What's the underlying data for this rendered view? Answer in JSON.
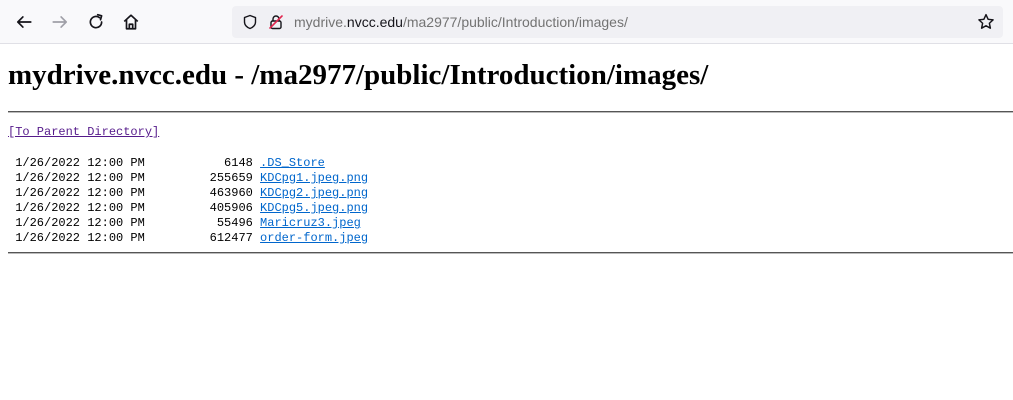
{
  "browser": {
    "url_domain": "mydrive.nvcc.edu",
    "url_path": "/ma2977/public/Introduction/images/",
    "url_prefix": "mydrive."
  },
  "page": {
    "heading": "mydrive.nvcc.edu - /ma2977/public/Introduction/images/",
    "parent_link": "[To Parent Directory]",
    "files": [
      {
        "date": "1/26/2022",
        "time": "12:00 PM",
        "size": "6148",
        "name": ".DS_Store"
      },
      {
        "date": "1/26/2022",
        "time": "12:00 PM",
        "size": "255659",
        "name": "KDCpg1.jpeg.png"
      },
      {
        "date": "1/26/2022",
        "time": "12:00 PM",
        "size": "463960",
        "name": "KDCpg2.jpeg.png"
      },
      {
        "date": "1/26/2022",
        "time": "12:00 PM",
        "size": "405906",
        "name": "KDCpg5.jpeg.png"
      },
      {
        "date": "1/26/2022",
        "time": "12:00 PM",
        "size": "55496",
        "name": "Maricruz3.jpeg"
      },
      {
        "date": "1/26/2022",
        "time": "12:00 PM",
        "size": "612477",
        "name": "order-form.jpeg"
      }
    ]
  },
  "colors": {
    "link": "#0066cc",
    "visited_link": "#551a8b"
  },
  "icons": [
    "back-arrow-icon",
    "forward-arrow-icon",
    "reload-icon",
    "home-icon",
    "shield-icon",
    "insecure-lock-icon",
    "bookmark-star-icon"
  ]
}
